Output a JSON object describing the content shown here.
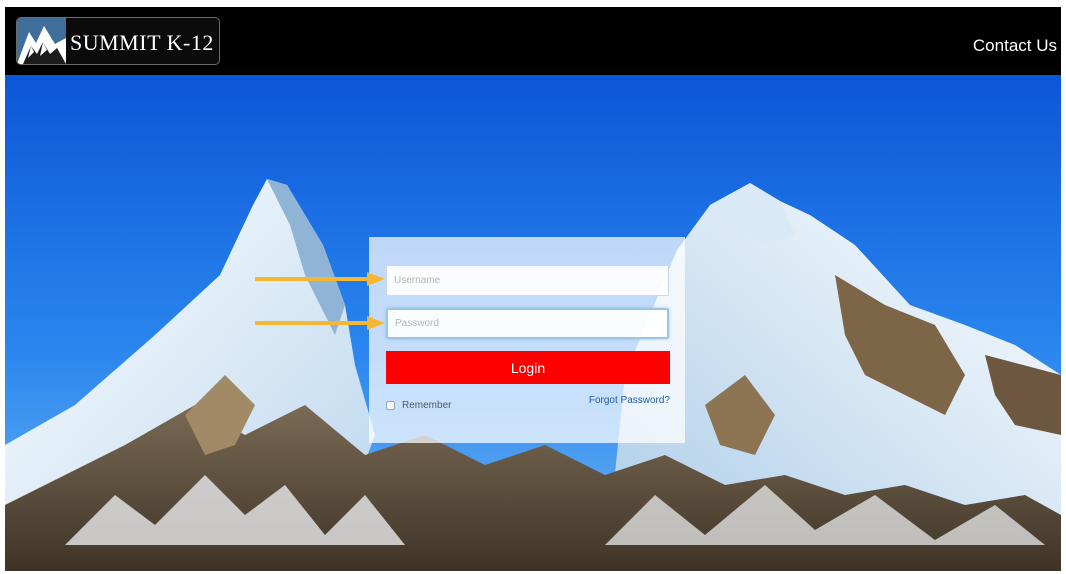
{
  "header": {
    "logo_text": "SUMMIT K-12",
    "contact_label": "Contact Us"
  },
  "login": {
    "username_placeholder": "Username",
    "password_placeholder": "Password",
    "login_label": "Login",
    "remember_label": "Remember",
    "forgot_label": "Forgot Password?"
  },
  "icons": {
    "logo": "mountain-logo-icon",
    "arrows": "arrow-right-icon"
  },
  "colors": {
    "navbar": "#000000",
    "login_button": "#fe0000",
    "arrow": "#f5b731",
    "link": "#1f5fa8",
    "sky": "#1f6fe6"
  }
}
